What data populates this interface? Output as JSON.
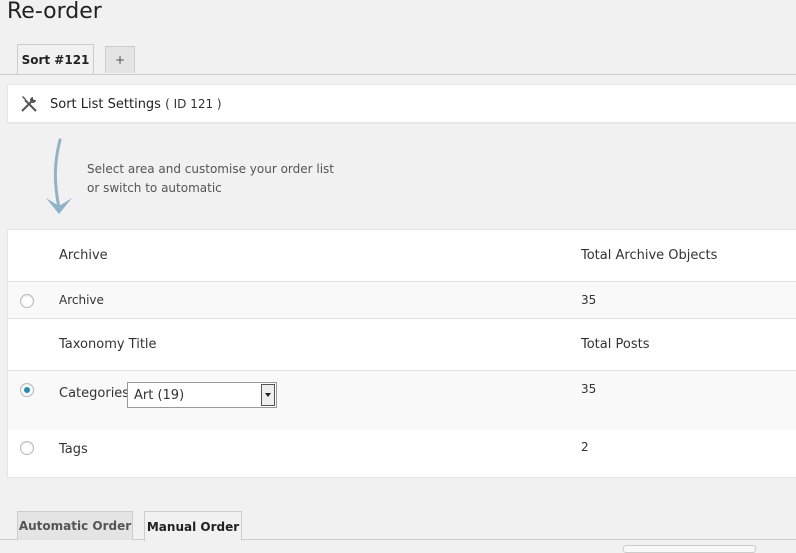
{
  "page": {
    "title": "Re-order"
  },
  "tabs": [
    {
      "label": "Sort #121",
      "active": true
    },
    {
      "label": "+",
      "active": false
    }
  ],
  "settings": {
    "title": "Sort List Settings",
    "id_text": "( ID 121 )",
    "icon": "tools-icon"
  },
  "hint": {
    "line1": "Select area and customise your order list",
    "line2": "or switch to automatic"
  },
  "archive_section": {
    "header_left": "Archive",
    "header_right": "Total Archive Objects",
    "row": {
      "label": "Archive",
      "count": "35",
      "selected": false
    }
  },
  "taxonomy_section": {
    "header_left": "Taxonomy Title",
    "header_right": "Total Posts",
    "rows": [
      {
        "label": "Categories",
        "count": "35",
        "selected": true,
        "select_value": "Art  (19)"
      },
      {
        "label": "Tags",
        "count": "2",
        "selected": false
      }
    ]
  },
  "order_tabs": [
    {
      "label": "Automatic Order",
      "active": false
    },
    {
      "label": "Manual Order",
      "active": true
    }
  ],
  "colors": {
    "accent": "#1e8cbe",
    "arrow": "#8fb3c7"
  }
}
